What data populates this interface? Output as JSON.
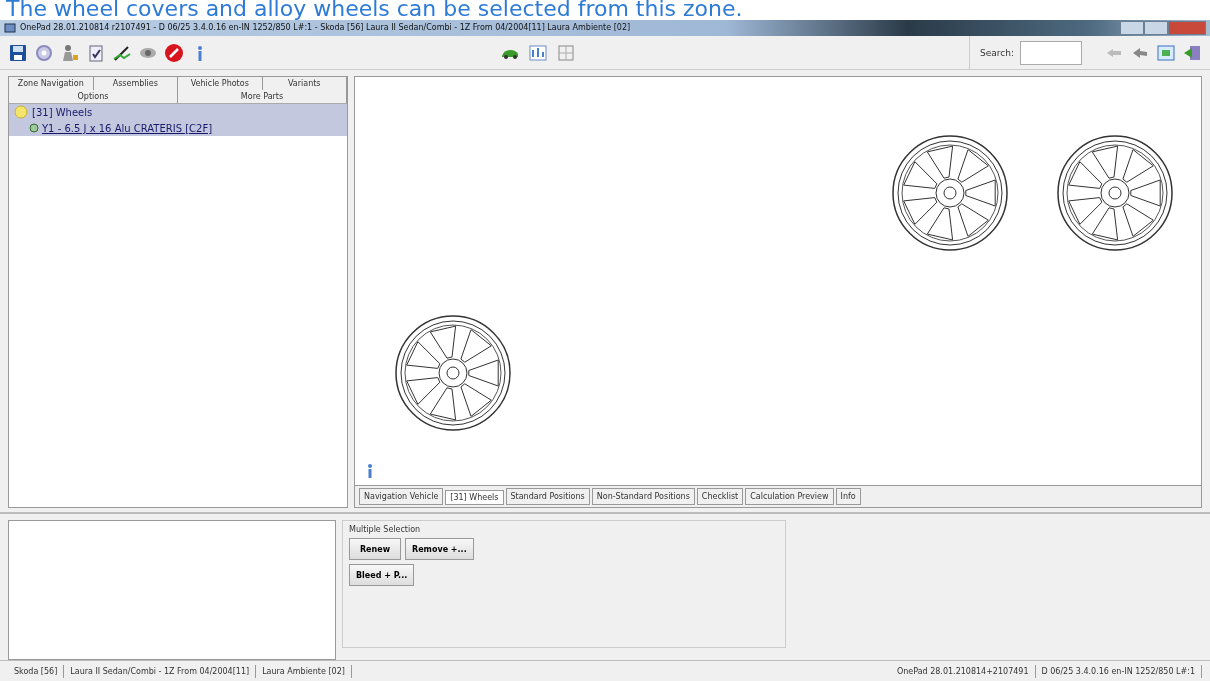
{
  "caption": "The wheel covers and alloy wheels can be selected from this zone.",
  "window": {
    "title": "OnePad 28.01.210814 r2107491 - D 06/25 3.4.0.16 en-IN 1252/850 L#:1 - Skoda [56] Laura II Sedan/Combi - 1Z From 04/2004[11] Laura Ambiente [02]"
  },
  "search": {
    "label": "Search:"
  },
  "left_tabs": [
    [
      {
        "label": "Zone Navigation",
        "selected": false
      },
      {
        "label": "Assemblies",
        "selected": false
      },
      {
        "label": "Vehicle Photos",
        "selected": false
      },
      {
        "label": "Variants",
        "selected": false
      }
    ],
    [
      {
        "label": "Options",
        "selected": false
      },
      {
        "label": "More Parts",
        "selected": false
      }
    ]
  ],
  "tree": [
    {
      "label": "[31] Wheels",
      "selected": true,
      "children": [
        {
          "label": "Y1 - 6.5 J x 16 Alu CRATERIS [C2F]",
          "selected": true
        }
      ]
    }
  ],
  "view_tabs": [
    {
      "label": "Navigation Vehicle",
      "selected": false
    },
    {
      "label": "[31] Wheels",
      "selected": true
    },
    {
      "label": "Standard Positions",
      "selected": false
    },
    {
      "label": "Non-Standard Positions",
      "selected": false
    },
    {
      "label": "Checklist",
      "selected": false
    },
    {
      "label": "Calculation Preview",
      "selected": false
    },
    {
      "label": "Info",
      "selected": false
    }
  ],
  "multiple_selection": {
    "title": "Multiple Selection",
    "buttons": [
      {
        "label": "Renew"
      },
      {
        "label": "Remove +..."
      },
      {
        "label": "Bleed + P..."
      }
    ]
  },
  "status_bar": {
    "left": [
      "Skoda [56]",
      "Laura II Sedan/Combi - 1Z From 04/2004[11]",
      "Laura Ambiente [02]"
    ],
    "right": [
      "OnePad 28.01.210814+2107491",
      "D 06/25 3.4.0.16 en-IN 1252/850 L#:1"
    ]
  }
}
